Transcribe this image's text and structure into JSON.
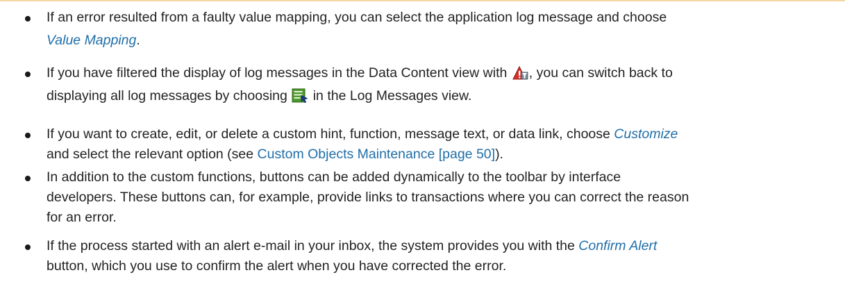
{
  "items": [
    {
      "line1": "If an error resulted from a faulty value mapping, you can select the application log message and choose",
      "term": "Value Mapping",
      "end": "."
    },
    {
      "line1_a": "If you have filtered the display of log messages in the Data Content view with",
      "line1_b": ", you can switch back to",
      "line2_a": "displaying all log messages by choosing",
      "line2_b": "in the Log Messages view.",
      "icon1": "filter-warning-icon",
      "icon2": "show-all-messages-icon"
    },
    {
      "line1_a": "If you want to create, edit, or delete a custom hint, function, message text, or data link, choose",
      "term": "Customize",
      "line2_a": "and select the relevant option (see",
      "link": "Custom Objects Maintenance [page 50]",
      "line2_b": ")."
    },
    {
      "line1": "In addition to the custom functions, buttons can be added dynamically to the toolbar by interface",
      "line2": "developers. These buttons can, for example, provide links to transactions where you can correct the reason",
      "line3": "for an error."
    },
    {
      "line1_a": "If the process started with an alert e-mail in your inbox, the system provides you with the",
      "term": "Confirm Alert",
      "line2": "button, which you use to confirm the alert when you have corrected the error."
    }
  ],
  "colors": {
    "text": "#222222",
    "link": "#1f6ea8",
    "top_rule": "#f5d7a4"
  }
}
